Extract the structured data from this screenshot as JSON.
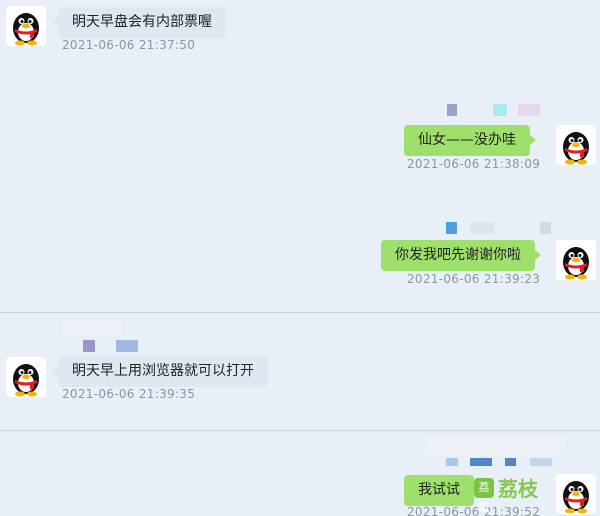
{
  "messages": [
    {
      "side": "left",
      "text": "明天早盘会有内部票喔",
      "time": "2021-06-06 21:37:50"
    },
    {
      "side": "right",
      "text": "仙女——没办哇",
      "time": "2021-06-06 21:38:09"
    },
    {
      "side": "right",
      "text": "你发我吧先谢谢你啦",
      "time": "2021-06-06 21:39:23"
    },
    {
      "side": "left",
      "text": "明天早上用浏览器就可以打开",
      "time": "2021-06-06 21:39:35"
    },
    {
      "side": "right",
      "text": "我试试",
      "time": "2021-06-06 21:39:52"
    }
  ],
  "watermark": {
    "logo": "荔枝",
    "text": "荔枝"
  },
  "colors": {
    "background": "#e9eff7",
    "left_bubble": "#dfe7f1",
    "right_bubble": "#9ee06b",
    "timestamp": "#8a96a3"
  },
  "icons": {
    "avatar": "qq-penguin-icon"
  }
}
